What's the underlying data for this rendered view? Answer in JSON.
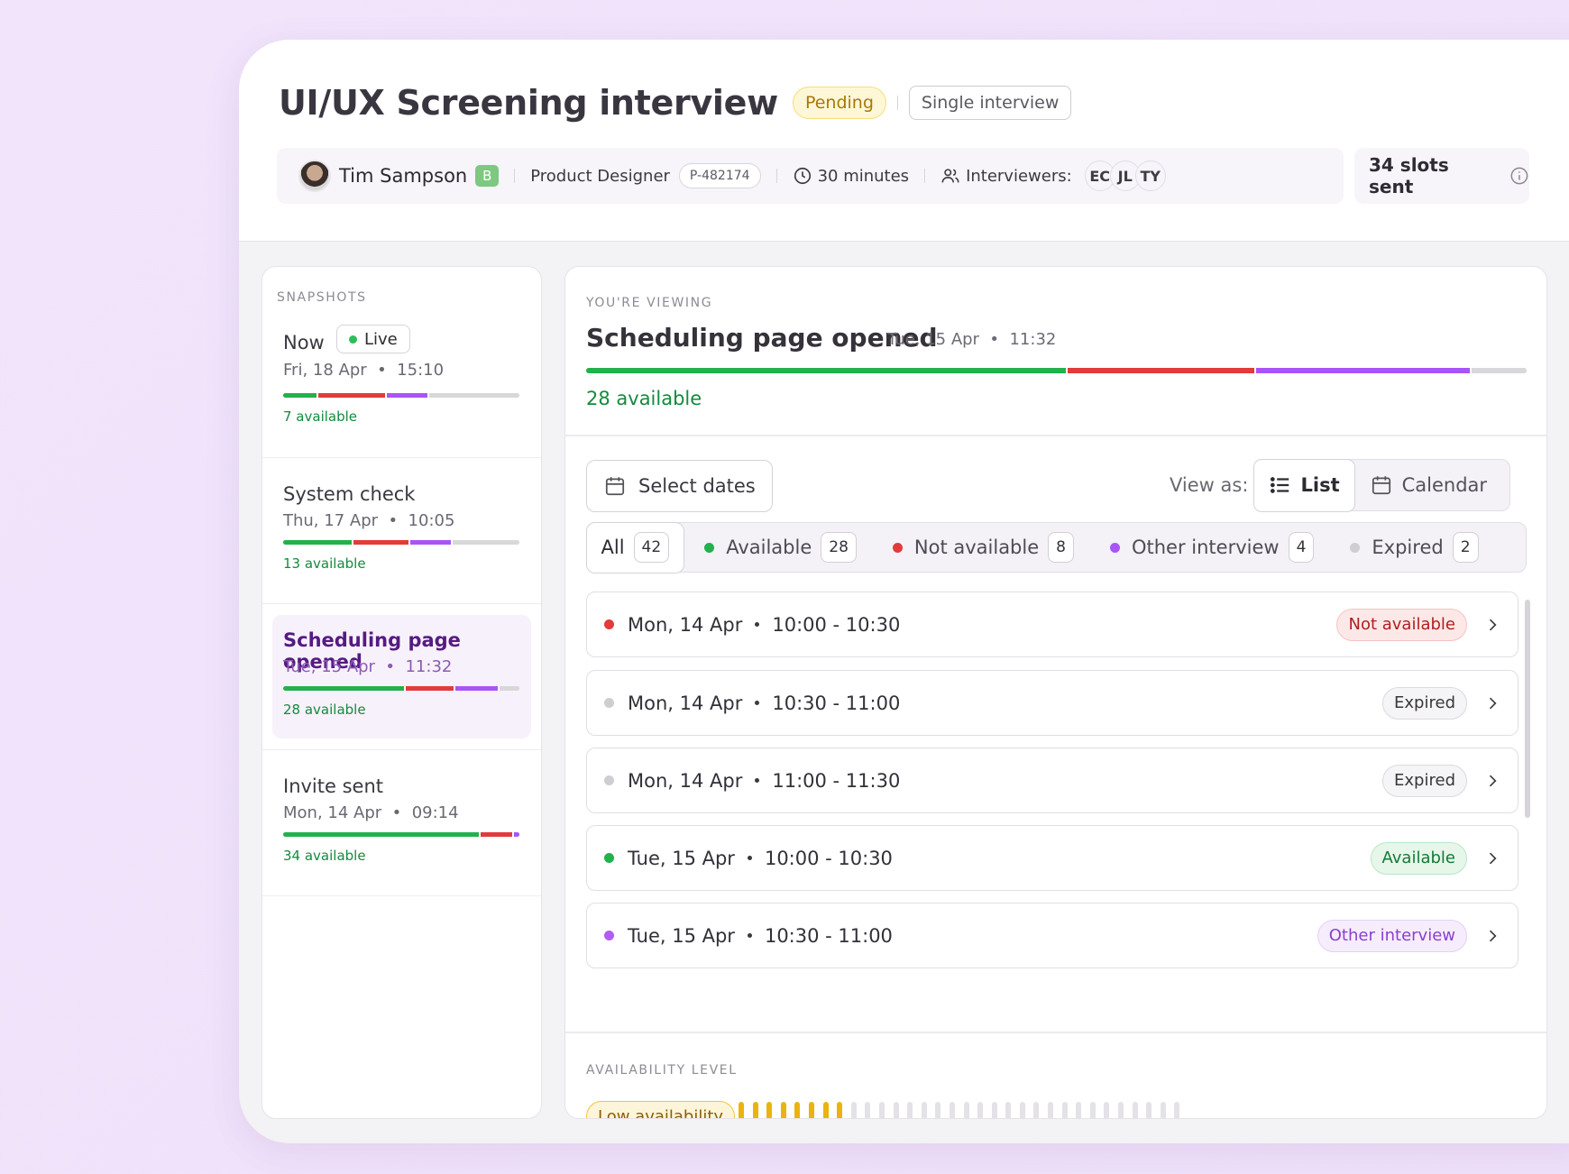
{
  "header": {
    "title": "UI/UX Screening interview",
    "status_badge": "Pending",
    "type_badge": "Single interview",
    "candidate": {
      "name": "Tim Sampson",
      "level": "B"
    },
    "role": "Product Designer",
    "position_id": "P-482174",
    "duration": "30 minutes",
    "interviewers_label": "Interviewers:",
    "interviewers": [
      "EC",
      "JL",
      "TY"
    ],
    "slots_sent": "34 slots sent"
  },
  "snapshots": {
    "label": "SNAPSHOTS",
    "live_label": "Live",
    "items": [
      {
        "title": "Now",
        "date": "Fri, 18 Apr",
        "time": "15:10",
        "available": "7 available",
        "split": [
          0.14,
          0.29,
          0.18,
          0.39
        ]
      },
      {
        "title": "System check",
        "date": "Thu, 17 Apr",
        "time": "10:05",
        "available": "13 available",
        "split": [
          0.29,
          0.24,
          0.18,
          0.29
        ]
      },
      {
        "title": "Scheduling page opened",
        "date": "Tue, 15 Apr",
        "time": "11:32",
        "available": "28 available",
        "split": [
          0.51,
          0.21,
          0.19,
          0.09
        ]
      },
      {
        "title": "Invite sent",
        "date": "Mon, 14 Apr",
        "time": "09:14",
        "available": "34 available",
        "split": [
          0.83,
          0.14,
          0.03,
          0.0
        ]
      }
    ]
  },
  "viewing": {
    "label": "YOU'RE VIEWING",
    "title": "Scheduling page opened",
    "date": "Tue, 15 Apr",
    "time": "11:32",
    "available": "28 available",
    "split": [
      0.51,
      0.2,
      0.23,
      0.06
    ]
  },
  "toolbar": {
    "select_dates": "Select dates",
    "view_as": "View as:",
    "list": "List",
    "calendar": "Calendar"
  },
  "filters": [
    {
      "label": "All",
      "count": "42",
      "color": ""
    },
    {
      "label": "Available",
      "count": "28",
      "color": "#22b14c"
    },
    {
      "label": "Not available",
      "count": "8",
      "color": "#e23b3b"
    },
    {
      "label": "Other interview",
      "count": "4",
      "color": "#a855f7"
    },
    {
      "label": "Expired",
      "count": "2",
      "color": "#cfcdd1"
    }
  ],
  "slots": [
    {
      "date": "Mon, 14 Apr",
      "time": "10:00 - 10:30",
      "status": "Not available",
      "dot": "#e23b3b"
    },
    {
      "date": "Mon, 14 Apr",
      "time": "10:30 - 11:00",
      "status": "Expired",
      "dot": "#cfcdd1"
    },
    {
      "date": "Mon, 14 Apr",
      "time": "11:00 - 11:30",
      "status": "Expired",
      "dot": "#cfcdd1"
    },
    {
      "date": "Tue, 15 Apr",
      "time": "10:00 - 10:30",
      "status": "Available",
      "dot": "#22b14c"
    },
    {
      "date": "Tue, 15 Apr",
      "time": "10:30 - 11:00",
      "status": "Other interview",
      "dot": "#b35df0"
    }
  ],
  "availability": {
    "label": "AVAILABILITY LEVEL",
    "level_text": "Low availability",
    "filled_bars": 8,
    "total_bars": 32
  },
  "colors": {
    "available": "#22b14c",
    "not_available": "#e23b3b",
    "other_interview": "#a855f7",
    "expired": "#d8d7da",
    "level_filled": "#ebb40d",
    "level_empty": "#e4e2e6"
  }
}
